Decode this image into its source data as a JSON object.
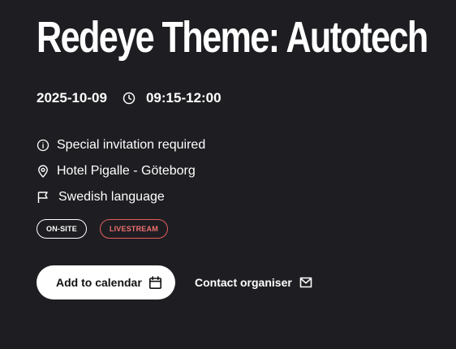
{
  "event": {
    "title": "Redeye Theme: Autotech",
    "date": "2025-10-09",
    "time": "09:15-12:00"
  },
  "details": {
    "invitation": "Special invitation required",
    "location": "Hotel Pigalle - Göteborg",
    "language": "Swedish language"
  },
  "tags": {
    "onsite": "ON-SITE",
    "livestream": "LIVESTREAM"
  },
  "actions": {
    "add_to_calendar": "Add to calendar",
    "contact_organiser": "Contact organiser"
  },
  "icons": {
    "time": "clock-icon",
    "invitation": "info-icon",
    "location": "location-pin-icon",
    "language": "flag-icon",
    "calendar": "calendar-icon",
    "contact": "mail-icon"
  },
  "colors": {
    "background": "#1e1e22",
    "text": "#ffffff",
    "livestream_accent": "#e35d5d",
    "button_background": "#ffffff",
    "button_text": "#111111"
  }
}
